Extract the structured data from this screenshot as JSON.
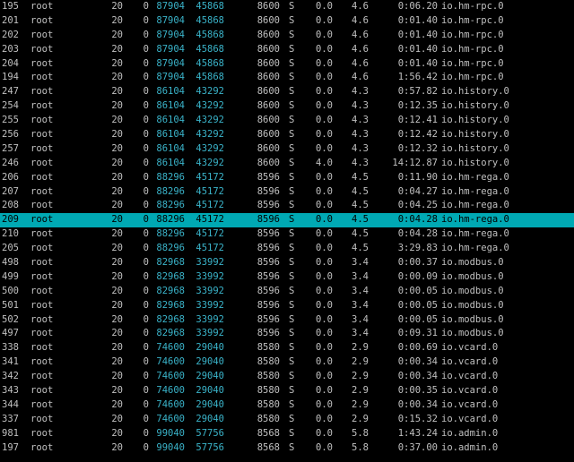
{
  "terminal": {
    "title": "",
    "colors": {
      "background": "#000000",
      "text": "#c0c0c0",
      "accent": "#3ab3c9",
      "selection": "#00a9b4"
    },
    "selected_index": 15,
    "processes": [
      {
        "pid": "195",
        "user": "root",
        "pr": "20",
        "ni": "0",
        "virt": "87904",
        "res": "45868",
        "shr": "8600",
        "s": "S",
        "cpu": "0.0",
        "mem": "4.6",
        "time": "0:06.20",
        "cmd": "io.hm-rpc.0"
      },
      {
        "pid": "201",
        "user": "root",
        "pr": "20",
        "ni": "0",
        "virt": "87904",
        "res": "45868",
        "shr": "8600",
        "s": "S",
        "cpu": "0.0",
        "mem": "4.6",
        "time": "0:01.40",
        "cmd": "io.hm-rpc.0"
      },
      {
        "pid": "202",
        "user": "root",
        "pr": "20",
        "ni": "0",
        "virt": "87904",
        "res": "45868",
        "shr": "8600",
        "s": "S",
        "cpu": "0.0",
        "mem": "4.6",
        "time": "0:01.40",
        "cmd": "io.hm-rpc.0"
      },
      {
        "pid": "203",
        "user": "root",
        "pr": "20",
        "ni": "0",
        "virt": "87904",
        "res": "45868",
        "shr": "8600",
        "s": "S",
        "cpu": "0.0",
        "mem": "4.6",
        "time": "0:01.40",
        "cmd": "io.hm-rpc.0"
      },
      {
        "pid": "204",
        "user": "root",
        "pr": "20",
        "ni": "0",
        "virt": "87904",
        "res": "45868",
        "shr": "8600",
        "s": "S",
        "cpu": "0.0",
        "mem": "4.6",
        "time": "0:01.40",
        "cmd": "io.hm-rpc.0"
      },
      {
        "pid": "194",
        "user": "root",
        "pr": "20",
        "ni": "0",
        "virt": "87904",
        "res": "45868",
        "shr": "8600",
        "s": "S",
        "cpu": "0.0",
        "mem": "4.6",
        "time": "1:56.42",
        "cmd": "io.hm-rpc.0"
      },
      {
        "pid": "247",
        "user": "root",
        "pr": "20",
        "ni": "0",
        "virt": "86104",
        "res": "43292",
        "shr": "8600",
        "s": "S",
        "cpu": "0.0",
        "mem": "4.3",
        "time": "0:57.82",
        "cmd": "io.history.0"
      },
      {
        "pid": "254",
        "user": "root",
        "pr": "20",
        "ni": "0",
        "virt": "86104",
        "res": "43292",
        "shr": "8600",
        "s": "S",
        "cpu": "0.0",
        "mem": "4.3",
        "time": "0:12.35",
        "cmd": "io.history.0"
      },
      {
        "pid": "255",
        "user": "root",
        "pr": "20",
        "ni": "0",
        "virt": "86104",
        "res": "43292",
        "shr": "8600",
        "s": "S",
        "cpu": "0.0",
        "mem": "4.3",
        "time": "0:12.41",
        "cmd": "io.history.0"
      },
      {
        "pid": "256",
        "user": "root",
        "pr": "20",
        "ni": "0",
        "virt": "86104",
        "res": "43292",
        "shr": "8600",
        "s": "S",
        "cpu": "0.0",
        "mem": "4.3",
        "time": "0:12.42",
        "cmd": "io.history.0"
      },
      {
        "pid": "257",
        "user": "root",
        "pr": "20",
        "ni": "0",
        "virt": "86104",
        "res": "43292",
        "shr": "8600",
        "s": "S",
        "cpu": "0.0",
        "mem": "4.3",
        "time": "0:12.32",
        "cmd": "io.history.0"
      },
      {
        "pid": "246",
        "user": "root",
        "pr": "20",
        "ni": "0",
        "virt": "86104",
        "res": "43292",
        "shr": "8600",
        "s": "S",
        "cpu": "4.0",
        "mem": "4.3",
        "time": "14:12.87",
        "cmd": "io.history.0"
      },
      {
        "pid": "206",
        "user": "root",
        "pr": "20",
        "ni": "0",
        "virt": "88296",
        "res": "45172",
        "shr": "8596",
        "s": "S",
        "cpu": "0.0",
        "mem": "4.5",
        "time": "0:11.90",
        "cmd": "io.hm-rega.0"
      },
      {
        "pid": "207",
        "user": "root",
        "pr": "20",
        "ni": "0",
        "virt": "88296",
        "res": "45172",
        "shr": "8596",
        "s": "S",
        "cpu": "0.0",
        "mem": "4.5",
        "time": "0:04.27",
        "cmd": "io.hm-rega.0"
      },
      {
        "pid": "208",
        "user": "root",
        "pr": "20",
        "ni": "0",
        "virt": "88296",
        "res": "45172",
        "shr": "8596",
        "s": "S",
        "cpu": "0.0",
        "mem": "4.5",
        "time": "0:04.25",
        "cmd": "io.hm-rega.0"
      },
      {
        "pid": "209",
        "user": "root",
        "pr": "20",
        "ni": "0",
        "virt": "88296",
        "res": "45172",
        "shr": "8596",
        "s": "S",
        "cpu": "0.0",
        "mem": "4.5",
        "time": "0:04.28",
        "cmd": "io.hm-rega.0"
      },
      {
        "pid": "210",
        "user": "root",
        "pr": "20",
        "ni": "0",
        "virt": "88296",
        "res": "45172",
        "shr": "8596",
        "s": "S",
        "cpu": "0.0",
        "mem": "4.5",
        "time": "0:04.28",
        "cmd": "io.hm-rega.0"
      },
      {
        "pid": "205",
        "user": "root",
        "pr": "20",
        "ni": "0",
        "virt": "88296",
        "res": "45172",
        "shr": "8596",
        "s": "S",
        "cpu": "0.0",
        "mem": "4.5",
        "time": "3:29.83",
        "cmd": "io.hm-rega.0"
      },
      {
        "pid": "498",
        "user": "root",
        "pr": "20",
        "ni": "0",
        "virt": "82968",
        "res": "33992",
        "shr": "8596",
        "s": "S",
        "cpu": "0.0",
        "mem": "3.4",
        "time": "0:00.37",
        "cmd": "io.modbus.0"
      },
      {
        "pid": "499",
        "user": "root",
        "pr": "20",
        "ni": "0",
        "virt": "82968",
        "res": "33992",
        "shr": "8596",
        "s": "S",
        "cpu": "0.0",
        "mem": "3.4",
        "time": "0:00.09",
        "cmd": "io.modbus.0"
      },
      {
        "pid": "500",
        "user": "root",
        "pr": "20",
        "ni": "0",
        "virt": "82968",
        "res": "33992",
        "shr": "8596",
        "s": "S",
        "cpu": "0.0",
        "mem": "3.4",
        "time": "0:00.05",
        "cmd": "io.modbus.0"
      },
      {
        "pid": "501",
        "user": "root",
        "pr": "20",
        "ni": "0",
        "virt": "82968",
        "res": "33992",
        "shr": "8596",
        "s": "S",
        "cpu": "0.0",
        "mem": "3.4",
        "time": "0:00.05",
        "cmd": "io.modbus.0"
      },
      {
        "pid": "502",
        "user": "root",
        "pr": "20",
        "ni": "0",
        "virt": "82968",
        "res": "33992",
        "shr": "8596",
        "s": "S",
        "cpu": "0.0",
        "mem": "3.4",
        "time": "0:00.05",
        "cmd": "io.modbus.0"
      },
      {
        "pid": "497",
        "user": "root",
        "pr": "20",
        "ni": "0",
        "virt": "82968",
        "res": "33992",
        "shr": "8596",
        "s": "S",
        "cpu": "0.0",
        "mem": "3.4",
        "time": "0:09.31",
        "cmd": "io.modbus.0"
      },
      {
        "pid": "338",
        "user": "root",
        "pr": "20",
        "ni": "0",
        "virt": "74600",
        "res": "29040",
        "shr": "8580",
        "s": "S",
        "cpu": "0.0",
        "mem": "2.9",
        "time": "0:00.69",
        "cmd": "io.vcard.0"
      },
      {
        "pid": "341",
        "user": "root",
        "pr": "20",
        "ni": "0",
        "virt": "74600",
        "res": "29040",
        "shr": "8580",
        "s": "S",
        "cpu": "0.0",
        "mem": "2.9",
        "time": "0:00.34",
        "cmd": "io.vcard.0"
      },
      {
        "pid": "342",
        "user": "root",
        "pr": "20",
        "ni": "0",
        "virt": "74600",
        "res": "29040",
        "shr": "8580",
        "s": "S",
        "cpu": "0.0",
        "mem": "2.9",
        "time": "0:00.34",
        "cmd": "io.vcard.0"
      },
      {
        "pid": "343",
        "user": "root",
        "pr": "20",
        "ni": "0",
        "virt": "74600",
        "res": "29040",
        "shr": "8580",
        "s": "S",
        "cpu": "0.0",
        "mem": "2.9",
        "time": "0:00.35",
        "cmd": "io.vcard.0"
      },
      {
        "pid": "344",
        "user": "root",
        "pr": "20",
        "ni": "0",
        "virt": "74600",
        "res": "29040",
        "shr": "8580",
        "s": "S",
        "cpu": "0.0",
        "mem": "2.9",
        "time": "0:00.34",
        "cmd": "io.vcard.0"
      },
      {
        "pid": "337",
        "user": "root",
        "pr": "20",
        "ni": "0",
        "virt": "74600",
        "res": "29040",
        "shr": "8580",
        "s": "S",
        "cpu": "0.0",
        "mem": "2.9",
        "time": "0:15.32",
        "cmd": "io.vcard.0"
      },
      {
        "pid": "981",
        "user": "root",
        "pr": "20",
        "ni": "0",
        "virt": "99040",
        "res": "57756",
        "shr": "8568",
        "s": "S",
        "cpu": "0.0",
        "mem": "5.8",
        "time": "1:43.24",
        "cmd": "io.admin.0"
      },
      {
        "pid": "197",
        "user": "root",
        "pr": "20",
        "ni": "0",
        "virt": "99040",
        "res": "57756",
        "shr": "8568",
        "s": "S",
        "cpu": "0.0",
        "mem": "5.8",
        "time": "0:37.00",
        "cmd": "io.admin.0"
      }
    ]
  }
}
